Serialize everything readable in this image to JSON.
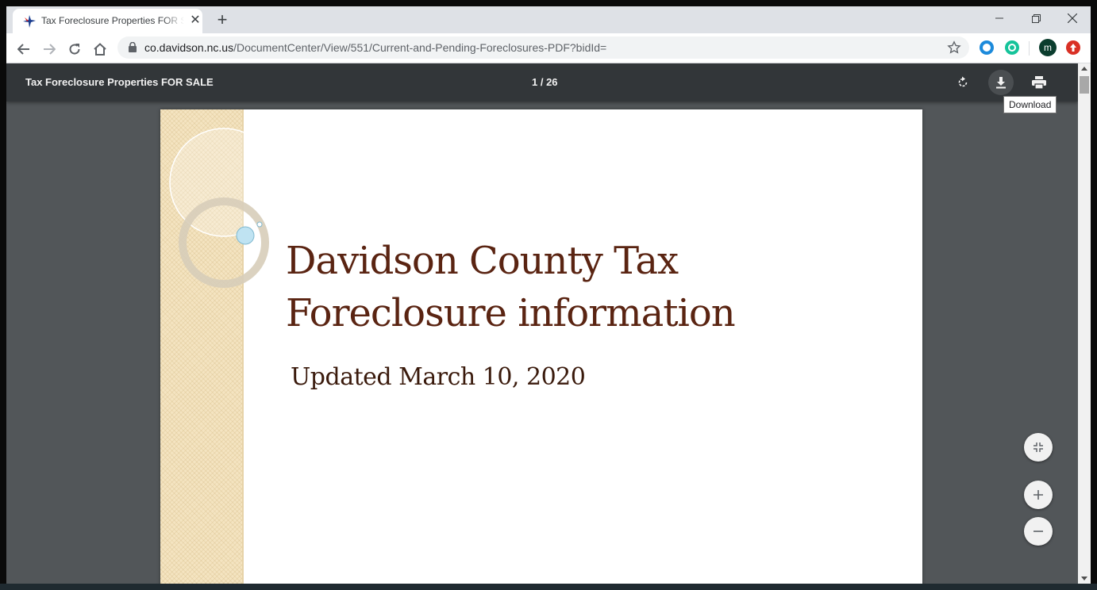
{
  "browser": {
    "tab_title": "Tax Foreclosure Properties FOR SALE",
    "url_domain": "co.davidson.nc.us",
    "url_path": "/DocumentCenter/View/551/Current-and-Pending-Foreclosures-PDF?bidId=",
    "profile_initial": "m"
  },
  "pdf_viewer": {
    "title": "Tax Foreclosure Properties FOR SALE",
    "page_indicator": "1 / 26",
    "tooltip": "Download"
  },
  "document": {
    "heading_line1": "Davidson County Tax",
    "heading_line2": "Foreclosure information",
    "subheading": "Updated March 10, 2020"
  },
  "colors": {
    "heading": "#5a2412",
    "viewer_bg": "#525659",
    "toolbar_bg": "#323639"
  }
}
